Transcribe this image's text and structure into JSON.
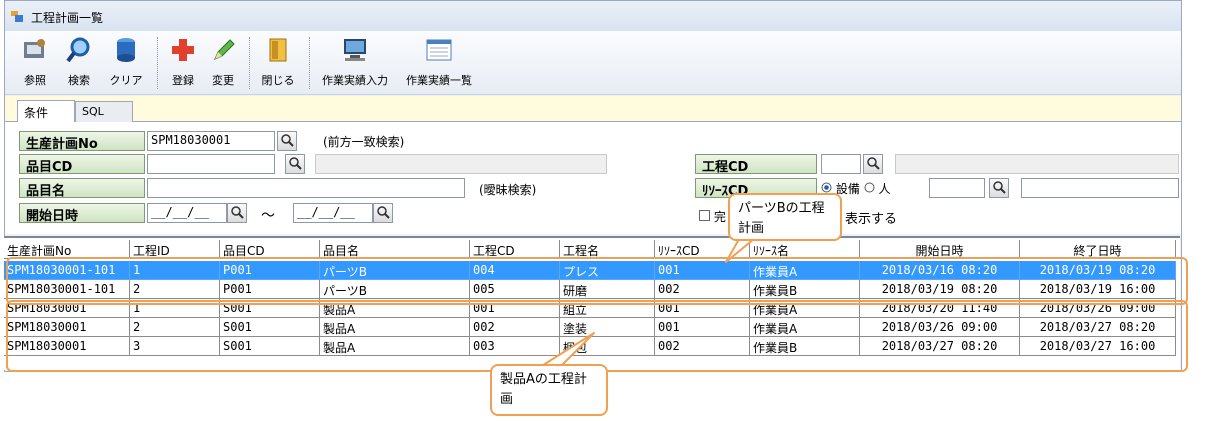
{
  "window": {
    "title": "工程計画一覧"
  },
  "toolbar": {
    "items": [
      {
        "label": "参照",
        "icon": "reference-icon"
      },
      {
        "label": "検索",
        "icon": "search-icon"
      },
      {
        "label": "クリア",
        "icon": "clear-icon"
      },
      {
        "label": "登録",
        "icon": "add-icon"
      },
      {
        "label": "変更",
        "icon": "edit-icon"
      },
      {
        "label": "閉じる",
        "icon": "close-door-icon"
      },
      {
        "label": "作業実績入力",
        "icon": "work-result-input-icon"
      },
      {
        "label": "作業実績一覧",
        "icon": "work-result-list-icon"
      }
    ]
  },
  "tabs": {
    "conditions": "条件",
    "sql": "SQL"
  },
  "conditions": {
    "plan_no": {
      "label": "生産計画No",
      "value": "SPM18030001",
      "note": "(前方一致検索)"
    },
    "item_cd": {
      "label": "品目CD",
      "value": ""
    },
    "item_name": {
      "label": "品目名",
      "value": "",
      "note": "(曖昧検索)"
    },
    "start_date": {
      "label": "開始日時",
      "from": "__/__/__",
      "tilde": "〜",
      "to": "__/__/__"
    },
    "process_cd": {
      "label": "工程CD",
      "value": ""
    },
    "resource_cd": {
      "label": "ﾘｿｰｽCD",
      "options": [
        "設備",
        "人"
      ],
      "selected": "設備",
      "value": ""
    },
    "complete_checkbox_label": "完",
    "show_label": "表示する"
  },
  "grid": {
    "headers": [
      "生産計画No",
      "工程ID",
      "品目CD",
      "品目名",
      "工程CD",
      "工程名",
      "ﾘｿｰｽCD",
      "ﾘｿｰｽ名",
      "開始日時",
      "終了日時"
    ],
    "rows": [
      [
        "SPM18030001-101",
        "1",
        "P001",
        "パーツB",
        "004",
        "プレス",
        "001",
        "作業員A",
        "2018/03/16 08:20",
        "2018/03/19 08:20"
      ],
      [
        "SPM18030001-101",
        "2",
        "P001",
        "パーツB",
        "005",
        "研磨",
        "002",
        "作業員B",
        "2018/03/19 08:20",
        "2018/03/19 16:00"
      ],
      [
        "SPM18030001",
        "1",
        "S001",
        "製品A",
        "001",
        "組立",
        "001",
        "作業員A",
        "2018/03/20 11:40",
        "2018/03/26 09:00"
      ],
      [
        "SPM18030001",
        "2",
        "S001",
        "製品A",
        "002",
        "塗装",
        "001",
        "作業員A",
        "2018/03/26 09:00",
        "2018/03/27 08:20"
      ],
      [
        "SPM18030001",
        "3",
        "S001",
        "製品A",
        "003",
        "梱包",
        "002",
        "作業員B",
        "2018/03/27 08:20",
        "2018/03/27 16:00"
      ]
    ],
    "selected_row": 0
  },
  "annotations": {
    "parts_b": "パーツBの工程計画",
    "product_a": "製品Aの工程計画"
  },
  "colors": {
    "selection": "#3399ff",
    "highlight": "#f0a050",
    "tab_strip": "#fffbdc"
  }
}
